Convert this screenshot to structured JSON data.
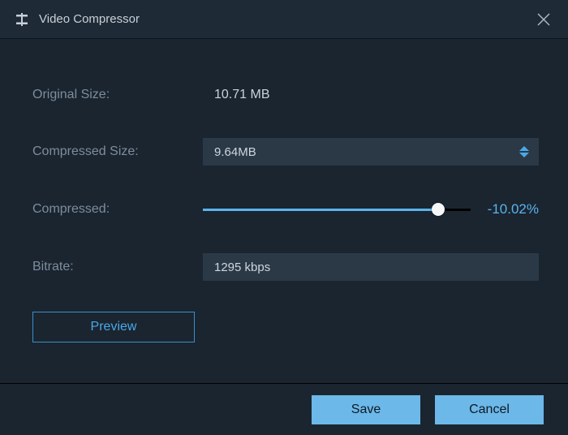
{
  "window": {
    "title": "Video Compressor"
  },
  "labels": {
    "original_size": "Original Size:",
    "compressed_size": "Compressed Size:",
    "compressed": "Compressed:",
    "bitrate": "Bitrate:"
  },
  "values": {
    "original_size": "10.71 MB",
    "compressed_size": "9.64MB",
    "compressed_percent": "-10.02%",
    "bitrate": "1295 kbps"
  },
  "slider": {
    "fill_percent": 88
  },
  "buttons": {
    "preview": "Preview",
    "save": "Save",
    "cancel": "Cancel"
  },
  "colors": {
    "accent": "#5bb3ec",
    "field_bg": "#2b3946",
    "bg": "#1a2530"
  }
}
